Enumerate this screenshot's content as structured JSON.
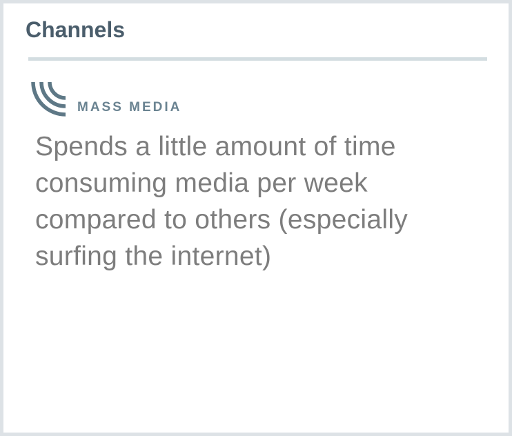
{
  "card": {
    "title": "Channels"
  },
  "channel": {
    "icon": "broadcast-waves-icon",
    "label": "MASS MEDIA",
    "description": "Spends a little amount of time consuming media per week compared to others (especially surfing the internet)"
  },
  "colors": {
    "title": "#4a5d6b",
    "icon": "#5e7886",
    "label": "#6a8391",
    "text": "#7d7d7d",
    "divider": "#d3dde1",
    "border": "#dde2e6"
  }
}
